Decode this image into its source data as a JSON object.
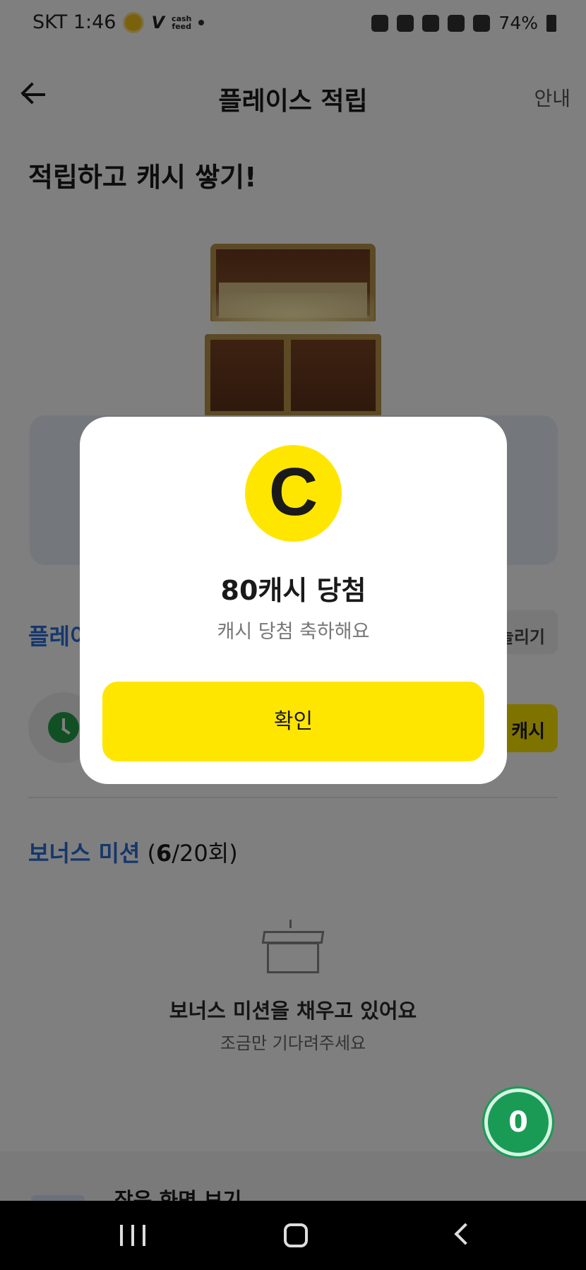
{
  "status_bar": {
    "carrier_time": "SKT 1:46",
    "app_badge": "V",
    "cash_line1": "cash",
    "cash_line2": "feed",
    "battery": "74%"
  },
  "header": {
    "title": "플레이스 적립",
    "guide_label": "안내"
  },
  "hero": {
    "title": "적립하고 캐시 쌓기!"
  },
  "place_section": {
    "title": "플레이",
    "more_label": "늘리기",
    "reward_label": "캐시"
  },
  "bonus_section": {
    "name": "보너스 미션",
    "open": " (",
    "current": "6",
    "rest": "/20회)"
  },
  "empty_state": {
    "title": "보너스 미션을 채우고 있어요",
    "subtitle": "조금만 기다려주세요"
  },
  "fab": {
    "count": "0"
  },
  "bottom": {
    "item_label": "잠은 화면 보기"
  },
  "modal": {
    "coin_symbol": "C",
    "title": "80캐시 당첨",
    "subtitle": "캐시 당첨 축하해요",
    "confirm_label": "확인"
  },
  "colors": {
    "accent_yellow": "#ffe600",
    "link_blue": "#2b6fd8",
    "fab_green": "#1a9b55"
  },
  "icons": [
    "back-arrow-icon",
    "chest-icon",
    "clock-icon",
    "box-icon",
    "coin-icon",
    "nav-recent-icon",
    "nav-home-icon",
    "nav-back-icon"
  ]
}
